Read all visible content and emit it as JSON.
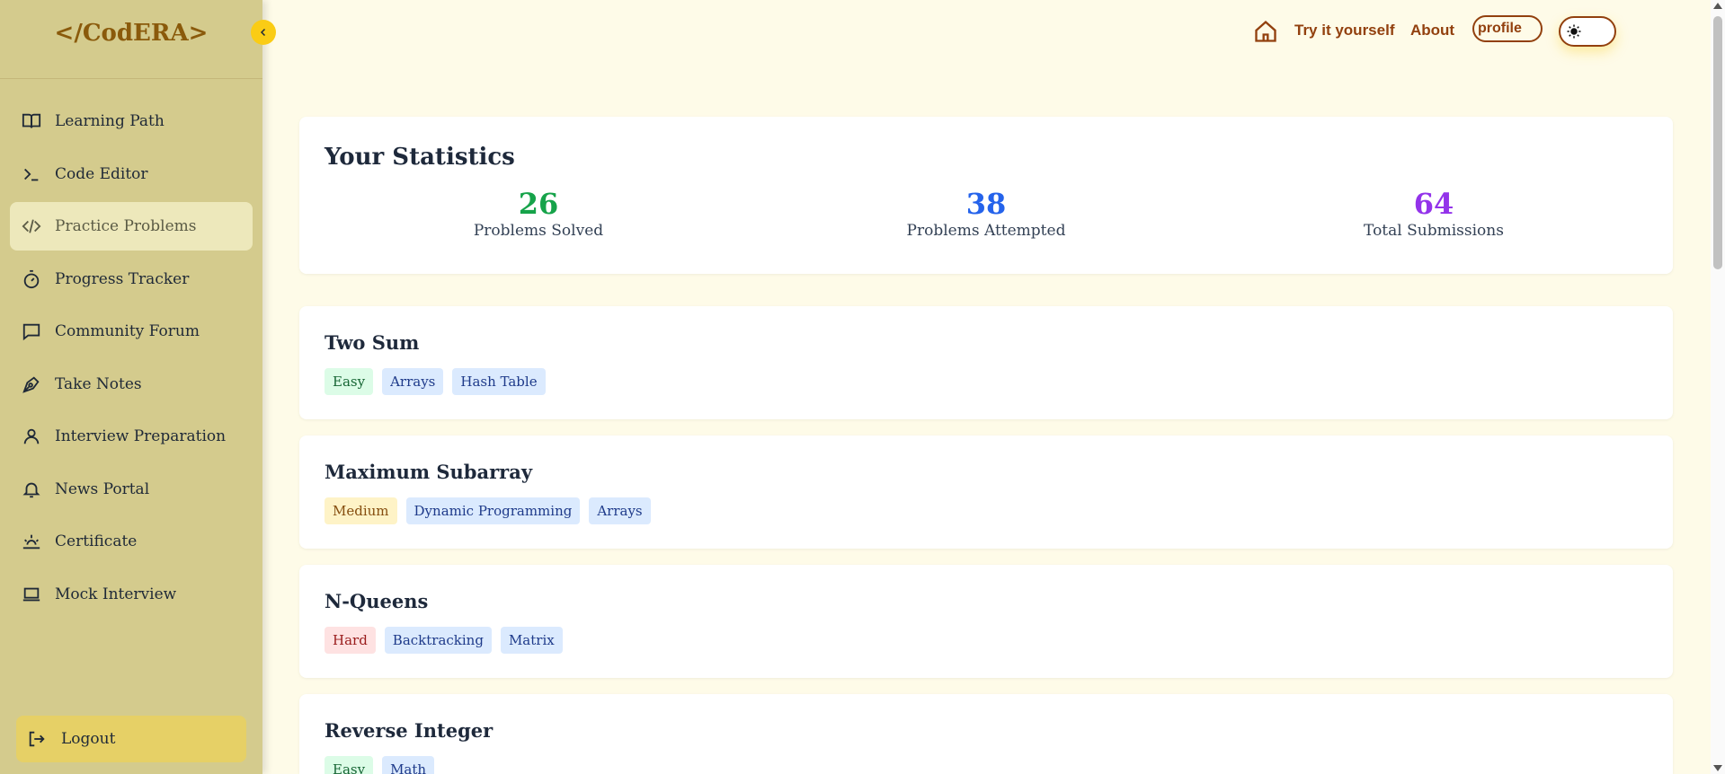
{
  "app": {
    "logo": "</CodERA>"
  },
  "sidebar": {
    "items": [
      {
        "label": "Learning Path",
        "icon": "book-icon"
      },
      {
        "label": "Code Editor",
        "icon": "terminal-icon"
      },
      {
        "label": "Practice Problems",
        "icon": "code-icon",
        "active": true
      },
      {
        "label": "Progress Tracker",
        "icon": "timer-icon"
      },
      {
        "label": "Community Forum",
        "icon": "chat-icon"
      },
      {
        "label": "Take Notes",
        "icon": "pen-icon"
      },
      {
        "label": "Interview Preparation",
        "icon": "user-icon"
      },
      {
        "label": "News Portal",
        "icon": "bell-icon"
      },
      {
        "label": "Certificate",
        "icon": "sunrise-icon"
      },
      {
        "label": "Mock Interview",
        "icon": "laptop-icon"
      }
    ],
    "logout": "Logout"
  },
  "topnav": {
    "try": "Try it yourself",
    "about": "About",
    "profile_alt": "profile"
  },
  "stats": {
    "title": "Your Statistics",
    "solved": {
      "value": "26",
      "label": "Problems Solved",
      "color": "#16a34a"
    },
    "attempted": {
      "value": "38",
      "label": "Problems Attempted",
      "color": "#2563eb"
    },
    "submissions": {
      "value": "64",
      "label": "Total Submissions",
      "color": "#9333ea"
    }
  },
  "problems": [
    {
      "title": "Two Sum",
      "tags": [
        "Easy",
        "Arrays",
        "Hash Table"
      ]
    },
    {
      "title": "Maximum Subarray",
      "tags": [
        "Medium",
        "Dynamic Programming",
        "Arrays"
      ]
    },
    {
      "title": "N-Queens",
      "tags": [
        "Hard",
        "Backtracking",
        "Matrix"
      ]
    },
    {
      "title": "Reverse Integer",
      "tags": [
        "Easy",
        "Math"
      ]
    }
  ],
  "colors": {
    "accent": "#92400e",
    "sidebar": "#d4cb8d",
    "toggle": "#facc15"
  }
}
